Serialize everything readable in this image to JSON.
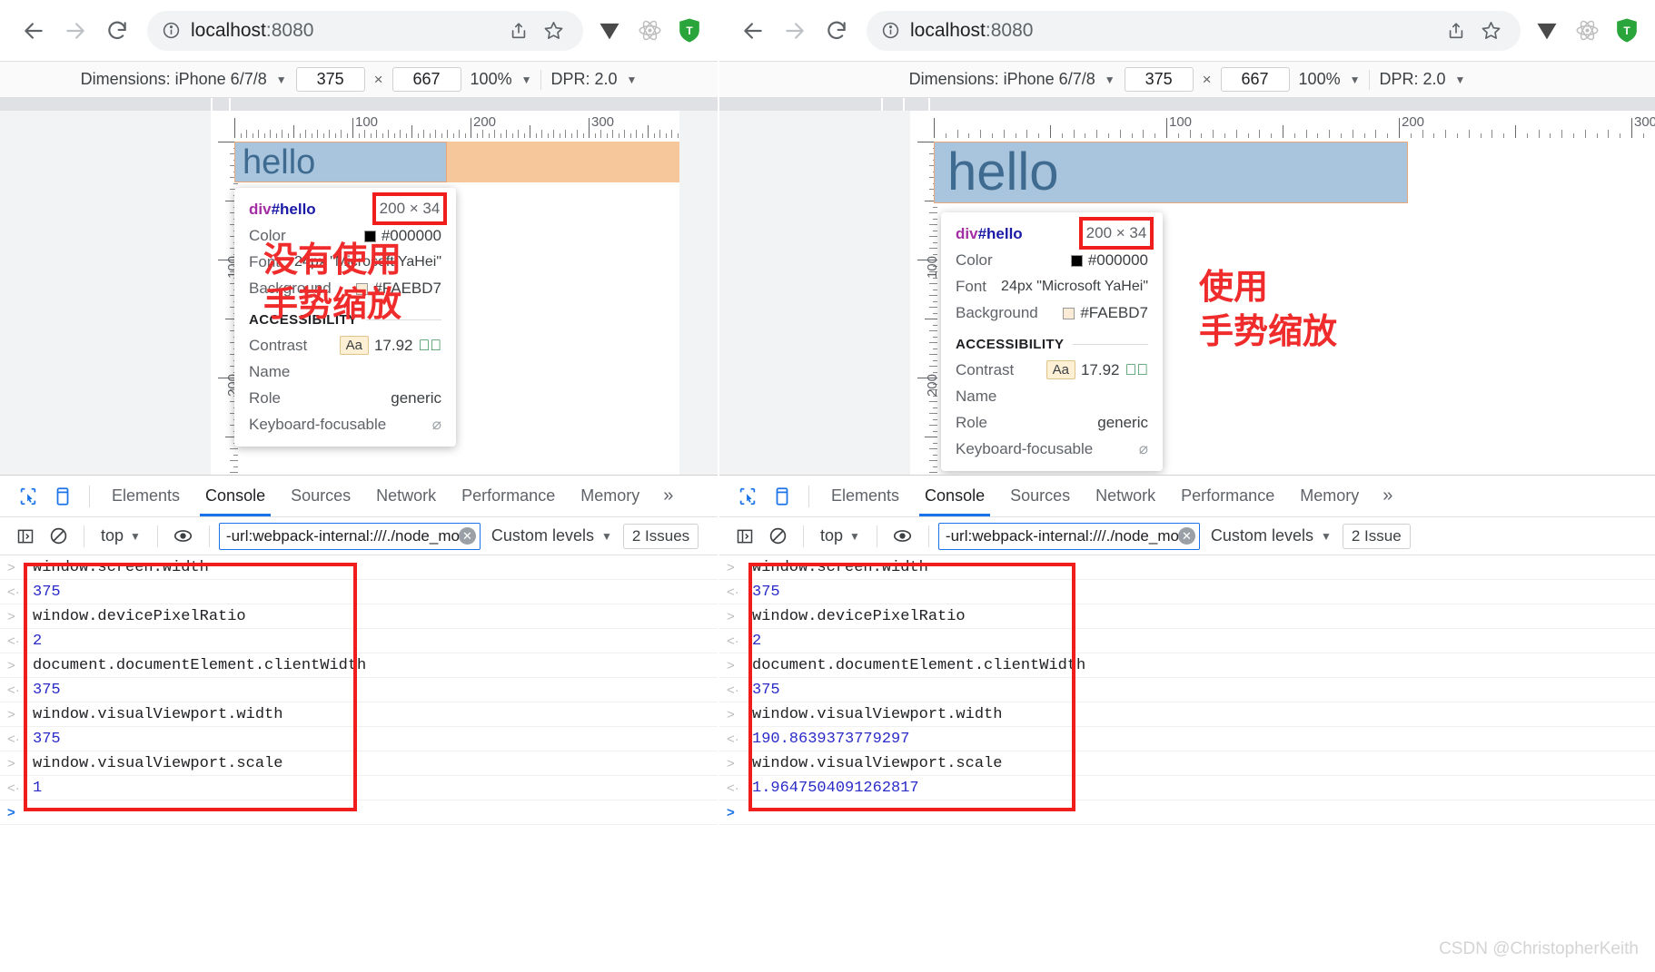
{
  "watermark": "CSDN @ChristopherKeith",
  "panels": [
    {
      "key": "left",
      "browser": {
        "back_icon": "back-arrow-icon",
        "forward_icon": "forward-arrow-icon",
        "reload_icon": "reload-icon",
        "info_icon": "site-info-icon",
        "url_host": "localhost",
        "url_port": ":8080",
        "share_icon": "share-icon",
        "bookmark_icon": "star-icon",
        "ext1_icon": "vimium-extension-icon",
        "ext2_icon": "react-devtools-extension-icon",
        "ext3_icon": "trend-micro-extension-icon"
      },
      "device_bar": {
        "dimensions_label": "Dimensions: iPhone 6/7/8",
        "width": "375",
        "times": "×",
        "height": "667",
        "zoom": "100%",
        "dpr": "DPR: 2.0"
      },
      "ruler": {
        "h_labels": [
          "100",
          "200",
          "300"
        ],
        "v_labels": [
          "100",
          "200"
        ]
      },
      "page": {
        "hello_text": "hello"
      },
      "tooltip": {
        "title_tag": "div",
        "title_id": "#hello",
        "size": "200 × 34",
        "rows": [
          {
            "key": "Color",
            "value": "#000000",
            "swatch": "#000000"
          },
          {
            "key": "Font",
            "value": "24px \"Microsoft YaHei\"",
            "swatch": null
          },
          {
            "key": "Background",
            "value": "#FAEBD7",
            "swatch": "#FAEBD7"
          }
        ],
        "section": "ACCESSIBILITY",
        "a11y": [
          {
            "key": "Contrast",
            "badge": "Aa",
            "value": "17.92",
            "mark": "ok"
          },
          {
            "key": "Name",
            "badge": null,
            "value": "",
            "mark": null
          },
          {
            "key": "Role",
            "badge": null,
            "value": "generic",
            "mark": null
          },
          {
            "key": "Keyboard-focusable",
            "badge": null,
            "value": "",
            "mark": "no"
          }
        ]
      },
      "annotation": "没有使用\n手势缩放",
      "devtools": {
        "inspect_icon": "inspect-element-icon",
        "device_toggle_icon": "device-toolbar-icon",
        "tabs": [
          {
            "label": "Elements",
            "active": false
          },
          {
            "label": "Console",
            "active": true
          },
          {
            "label": "Sources",
            "active": false
          },
          {
            "label": "Network",
            "active": false
          },
          {
            "label": "Performance",
            "active": false
          },
          {
            "label": "Memory",
            "active": false
          }
        ],
        "more_tabs": "»",
        "toolbar": {
          "sidebar_icon": "console-sidebar-icon",
          "clear_icon": "clear-console-icon",
          "context": "top",
          "eye_icon": "live-expression-icon",
          "filter_value": "-url:webpack-internal:///./node_modul",
          "filter_placeholder": "Filter",
          "clear_filter_icon": "clear-input-icon",
          "levels": "Custom levels",
          "issues": "2 Issues"
        },
        "lines": [
          {
            "type": "in",
            "text": "window.screen.width"
          },
          {
            "type": "out",
            "text": "375"
          },
          {
            "type": "in",
            "text": "window.devicePixelRatio"
          },
          {
            "type": "out",
            "text": "2"
          },
          {
            "type": "in",
            "text": "document.documentElement.clientWidth"
          },
          {
            "type": "out",
            "text": "375"
          },
          {
            "type": "in",
            "text": "window.visualViewport.width"
          },
          {
            "type": "out",
            "text": "375"
          },
          {
            "type": "in",
            "text": "window.visualViewport.scale"
          },
          {
            "type": "out",
            "text": "1"
          },
          {
            "type": "prompt",
            "text": ""
          }
        ]
      }
    },
    {
      "key": "right",
      "browser": {
        "back_icon": "back-arrow-icon",
        "forward_icon": "forward-arrow-icon",
        "reload_icon": "reload-icon",
        "info_icon": "site-info-icon",
        "url_host": "localhost",
        "url_port": ":8080",
        "share_icon": "share-icon",
        "bookmark_icon": "star-icon",
        "ext1_icon": "vimium-extension-icon",
        "ext2_icon": "react-devtools-extension-icon",
        "ext3_icon": "trend-micro-extension-icon"
      },
      "device_bar": {
        "dimensions_label": "Dimensions: iPhone 6/7/8",
        "width": "375",
        "times": "×",
        "height": "667",
        "zoom": "100%",
        "dpr": "DPR: 2.0"
      },
      "ruler": {
        "h_labels": [
          "100",
          "200",
          "300"
        ],
        "v_labels": [
          "100",
          "200"
        ]
      },
      "page": {
        "hello_text": "hello"
      },
      "tooltip": {
        "title_tag": "div",
        "title_id": "#hello",
        "size": "200 × 34",
        "rows": [
          {
            "key": "Color",
            "value": "#000000",
            "swatch": "#000000"
          },
          {
            "key": "Font",
            "value": "24px \"Microsoft YaHei\"",
            "swatch": null
          },
          {
            "key": "Background",
            "value": "#FAEBD7",
            "swatch": "#FAEBD7"
          }
        ],
        "section": "ACCESSIBILITY",
        "a11y": [
          {
            "key": "Contrast",
            "badge": "Aa",
            "value": "17.92",
            "mark": "ok"
          },
          {
            "key": "Name",
            "badge": null,
            "value": "",
            "mark": null
          },
          {
            "key": "Role",
            "badge": null,
            "value": "generic",
            "mark": null
          },
          {
            "key": "Keyboard-focusable",
            "badge": null,
            "value": "",
            "mark": "no"
          }
        ]
      },
      "annotation": "使用\n手势缩放",
      "devtools": {
        "inspect_icon": "inspect-element-icon",
        "device_toggle_icon": "device-toolbar-icon",
        "tabs": [
          {
            "label": "Elements",
            "active": false
          },
          {
            "label": "Console",
            "active": true
          },
          {
            "label": "Sources",
            "active": false
          },
          {
            "label": "Network",
            "active": false
          },
          {
            "label": "Performance",
            "active": false
          },
          {
            "label": "Memory",
            "active": false
          }
        ],
        "more_tabs": "»",
        "toolbar": {
          "sidebar_icon": "console-sidebar-icon",
          "clear_icon": "clear-console-icon",
          "context": "top",
          "eye_icon": "live-expression-icon",
          "filter_value": "-url:webpack-internal:///./node_modul",
          "filter_placeholder": "Filter",
          "clear_filter_icon": "clear-input-icon",
          "levels": "Custom levels",
          "issues": "2 Issue"
        },
        "lines": [
          {
            "type": "in",
            "text": "window.screen.width"
          },
          {
            "type": "out",
            "text": "375"
          },
          {
            "type": "in",
            "text": "window.devicePixelRatio"
          },
          {
            "type": "out",
            "text": "2"
          },
          {
            "type": "in",
            "text": "document.documentElement.clientWidth"
          },
          {
            "type": "out",
            "text": "375"
          },
          {
            "type": "in",
            "text": "window.visualViewport.width"
          },
          {
            "type": "out",
            "text": "190.8639373779297"
          },
          {
            "type": "in",
            "text": "window.visualViewport.scale"
          },
          {
            "type": "out",
            "text": "1.9647504091262817"
          },
          {
            "type": "prompt",
            "text": ""
          }
        ]
      }
    }
  ]
}
